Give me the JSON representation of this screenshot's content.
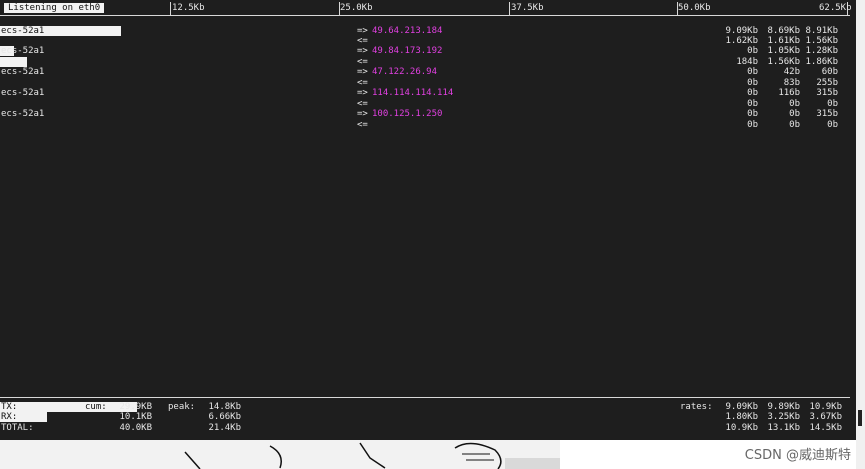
{
  "interface_label": "Listening on eth0",
  "scale_labels": [
    "12.5Kb",
    "25.0Kb",
    "37.5Kb",
    "50.0Kb",
    "62.5Kb"
  ],
  "flows": [
    {
      "host": "ecs-52a1",
      "dst": "49.64.213.184",
      "tx": [
        "9.09Kb",
        "8.69Kb",
        "8.91Kb"
      ],
      "rx": [
        "1.62Kb",
        "1.61Kb",
        "1.56Kb"
      ]
    },
    {
      "host": "ecs-52a1",
      "dst": "49.84.173.192",
      "tx": [
        "0b",
        "1.05Kb",
        "1.28Kb"
      ],
      "rx": [
        "184b",
        "1.56Kb",
        "1.86Kb"
      ]
    },
    {
      "host": "ecs-52a1",
      "dst": "47.122.26.94",
      "tx": [
        "0b",
        "42b",
        "60b"
      ],
      "rx": [
        "0b",
        "83b",
        "255b"
      ]
    },
    {
      "host": "ecs-52a1",
      "dst": "114.114.114.114",
      "tx": [
        "0b",
        "116b",
        "315b"
      ],
      "rx": [
        "0b",
        "0b",
        "0b"
      ]
    },
    {
      "host": "ecs-52a1",
      "dst": "100.125.1.250",
      "tx": [
        "0b",
        "0b",
        "315b"
      ],
      "rx": [
        "0b",
        "0b",
        "0b"
      ]
    }
  ],
  "arrows": {
    "out": "=>",
    "in": "<="
  },
  "totals": {
    "tx_label": "TX:",
    "rx_label": "RX:",
    "total_label": "TOTAL:",
    "cum_label": "cum:",
    "peak_label": "peak:",
    "rates_label": "rates:",
    "tx_cum": "29.9KB",
    "rx_cum": "10.1KB",
    "total_cum": "40.0KB",
    "tx_peak": "14.8Kb",
    "rx_peak": "6.66Kb",
    "total_peak": "21.4Kb",
    "tx_rates": [
      "9.09Kb",
      "9.89Kb",
      "10.9Kb"
    ],
    "rx_rates": [
      "1.80Kb",
      "3.25Kb",
      "3.67Kb"
    ],
    "total_rates": [
      "10.9Kb",
      "13.1Kb",
      "14.5Kb"
    ]
  },
  "watermark": "CSDN @威迪斯特"
}
